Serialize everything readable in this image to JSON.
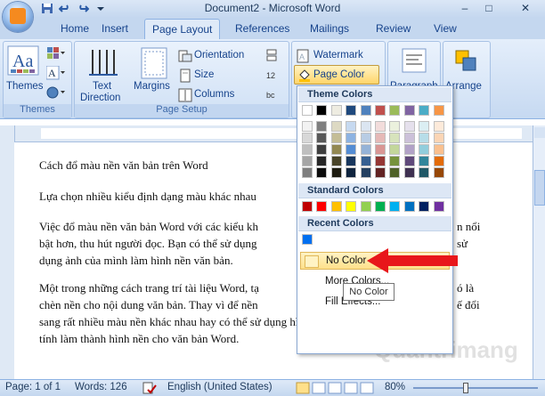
{
  "window": {
    "title": "Document2 - Microsoft Word",
    "minimize": "–",
    "maximize": "□",
    "close": "✕"
  },
  "tabs": [
    "Home",
    "Insert",
    "Page Layout",
    "References",
    "Mailings",
    "Review",
    "View"
  ],
  "ribbon": {
    "themes": {
      "label": "Themes",
      "group_label": "Themes"
    },
    "page_setup": {
      "text_direction_line1": "Text",
      "text_direction_line2": "Direction",
      "margins": "Margins",
      "orientation": "Orientation",
      "size": "Size",
      "columns": "Columns",
      "group_label": "Page Setup"
    },
    "page_background": {
      "watermark": "Watermark",
      "page_color": "Page Color"
    },
    "paragraph_partial": "Paragraph",
    "arrange": "Arrange"
  },
  "document": {
    "paragraphs": [
      [
        "Cách đổ màu nền văn bản trên Word"
      ],
      [
        "Lựa chọn nhiều kiểu định dạng màu khác nhau"
      ],
      [
        "Việc đổ màu nền văn bản Word với các kiểu kh",
        "bật hơn, thu hút người đọc. Bạn có thể sử dụng",
        "dụng ảnh của mình làm hình nền văn bản."
      ],
      [
        "Một trong những cách trang trí tài liệu Word, tạ",
        "chèn nền cho nội dung văn bản. Thay vì để nền",
        "sang rất nhiều màu nền khác nhau hay có thể sử dụng hình ảnh có sẵn trên máy",
        "tính làm thành hình nền cho văn bản Word."
      ]
    ],
    "right_fragments": [
      "n nổi",
      "sử",
      "ó là",
      "ế đổi"
    ]
  },
  "page_color_menu": {
    "theme_header": "Theme Colors",
    "theme_top": [
      "#ffffff",
      "#000000",
      "#eeece1",
      "#1f497d",
      "#4f81bd",
      "#c0504d",
      "#9bbb59",
      "#8064a2",
      "#4bacc6",
      "#f79646"
    ],
    "theme_tints": [
      [
        "#f2f2f2",
        "#7f7f7f",
        "#ddd9c3",
        "#c6d9f0",
        "#dbe5f1",
        "#f2dcdb",
        "#ebf1dd",
        "#e5e0ec",
        "#dbeef3",
        "#fdeada"
      ],
      [
        "#d8d8d8",
        "#595959",
        "#c4bd97",
        "#8db3e2",
        "#b8cce4",
        "#e5b9b7",
        "#d7e3bc",
        "#ccc1d9",
        "#b7dde8",
        "#fbd5b5"
      ],
      [
        "#bfbfbf",
        "#3f3f3f",
        "#938953",
        "#548dd4",
        "#95b3d7",
        "#d99694",
        "#c3d69b",
        "#b2a2c7",
        "#92cddc",
        "#fac08f"
      ],
      [
        "#a5a5a5",
        "#262626",
        "#494429",
        "#17365d",
        "#366092",
        "#953734",
        "#76923c",
        "#5f497a",
        "#31859b",
        "#e36c09"
      ],
      [
        "#7f7f7f",
        "#0c0c0c",
        "#1d1b10",
        "#0f243e",
        "#244061",
        "#632423",
        "#4f6128",
        "#3f3151",
        "#205867",
        "#974806"
      ]
    ],
    "standard_header": "Standard Colors",
    "standard": [
      "#c00000",
      "#ff0000",
      "#ffc000",
      "#ffff00",
      "#92d050",
      "#00b050",
      "#00b0f0",
      "#0070c0",
      "#002060",
      "#7030a0"
    ],
    "recent_header": "Recent Colors",
    "recent": [
      "#0070f0"
    ],
    "no_color": "No Color",
    "more_colors": "More Colors...",
    "fill_effects": "Fill Effects..."
  },
  "tooltip": "No Color",
  "status": {
    "page": "Page: 1 of 1",
    "words": "Words: 126",
    "language": "English (United States)",
    "zoom": "80%"
  },
  "watermark_text": "Quantrimang",
  "colors": {
    "arrow": "#e8171b",
    "highlight": "#ffe08a"
  }
}
